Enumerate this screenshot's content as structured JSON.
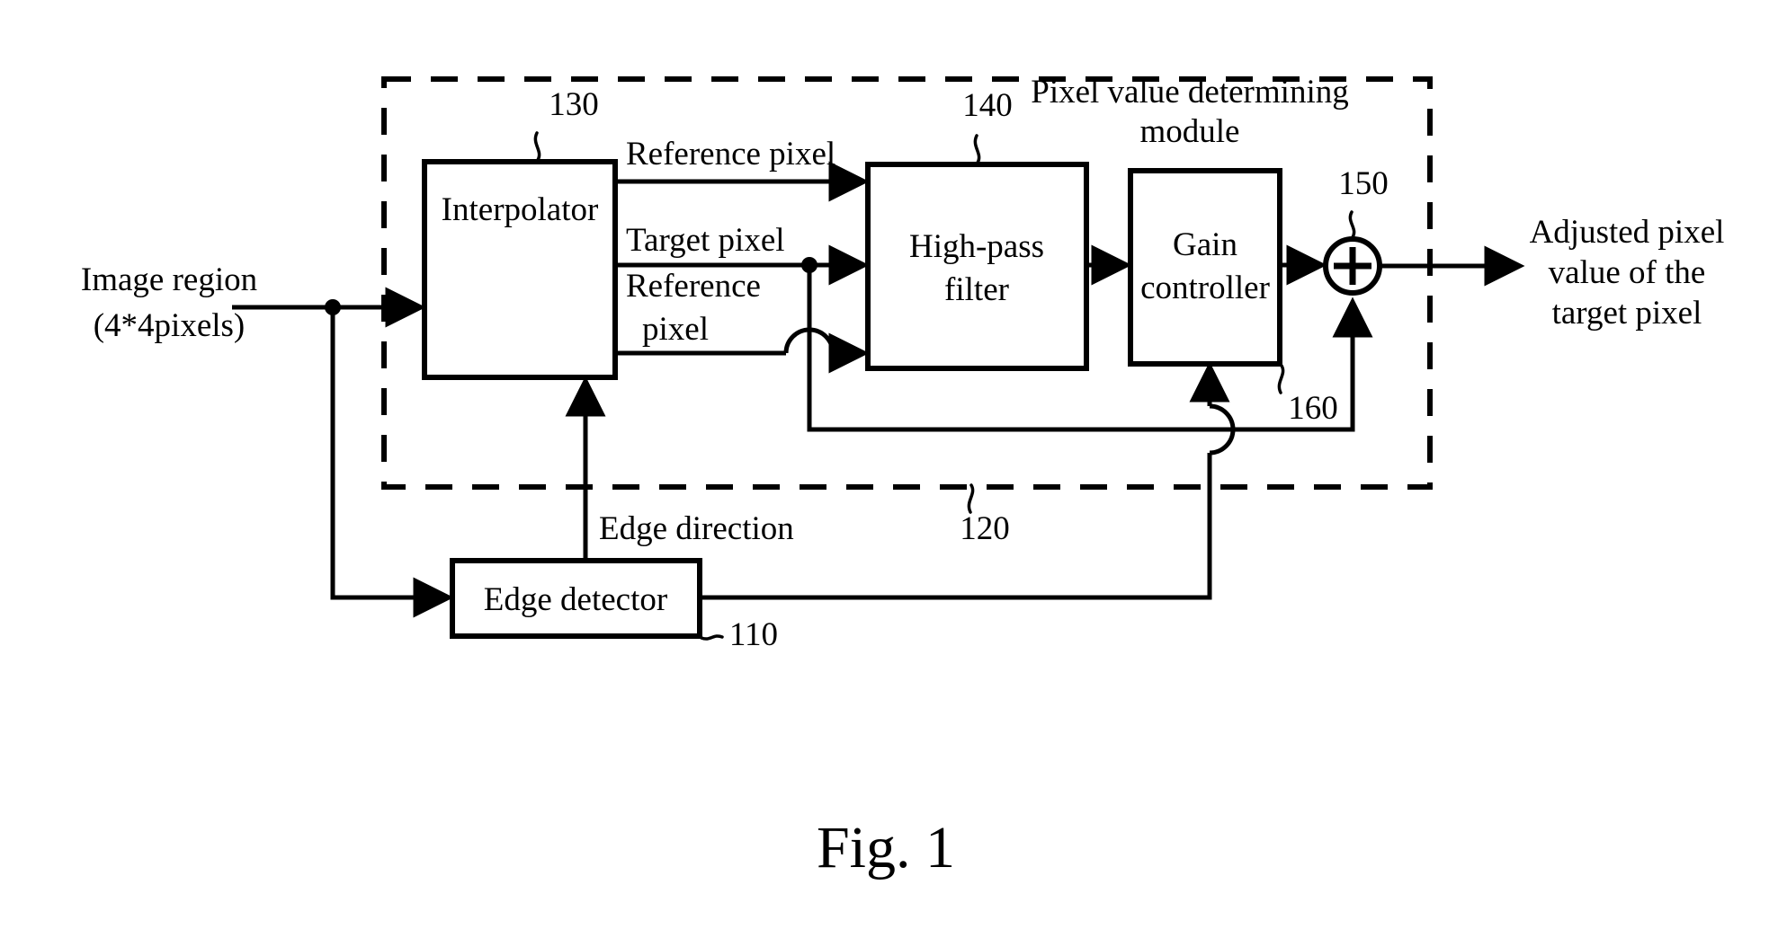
{
  "figure": {
    "caption": "Fig. 1"
  },
  "blocks": [
    {
      "id": "interpolator",
      "label": "Interpolator",
      "ref": "130"
    },
    {
      "id": "high-pass-filter",
      "label_line1": "High-pass",
      "label_line2": "filter",
      "ref": "140"
    },
    {
      "id": "gain-controller",
      "label_line1": "Gain",
      "label_line2": "controller",
      "ref": "160"
    },
    {
      "id": "edge-detector",
      "label": "Edge detector",
      "ref": "110"
    }
  ],
  "module": {
    "title_line1": "Pixel value determining",
    "title_line2": "module",
    "ref": "120"
  },
  "adder": {
    "symbol": "+",
    "ref": "150"
  },
  "io": {
    "input_line1": "Image region",
    "input_line2": "(4*4pixels)",
    "output_line1": "Adjusted pixel",
    "output_line2": "value of the",
    "output_line3": "target pixel"
  },
  "signals": {
    "reference_pixel_top": "Reference pixel",
    "target_pixel": "Target pixel",
    "reference_pixel_lower_line1": "Reference",
    "reference_pixel_lower_line2": "pixel",
    "edge_direction": "Edge direction"
  },
  "colors": {
    "ink": "#000000",
    "paper": "#ffffff"
  }
}
